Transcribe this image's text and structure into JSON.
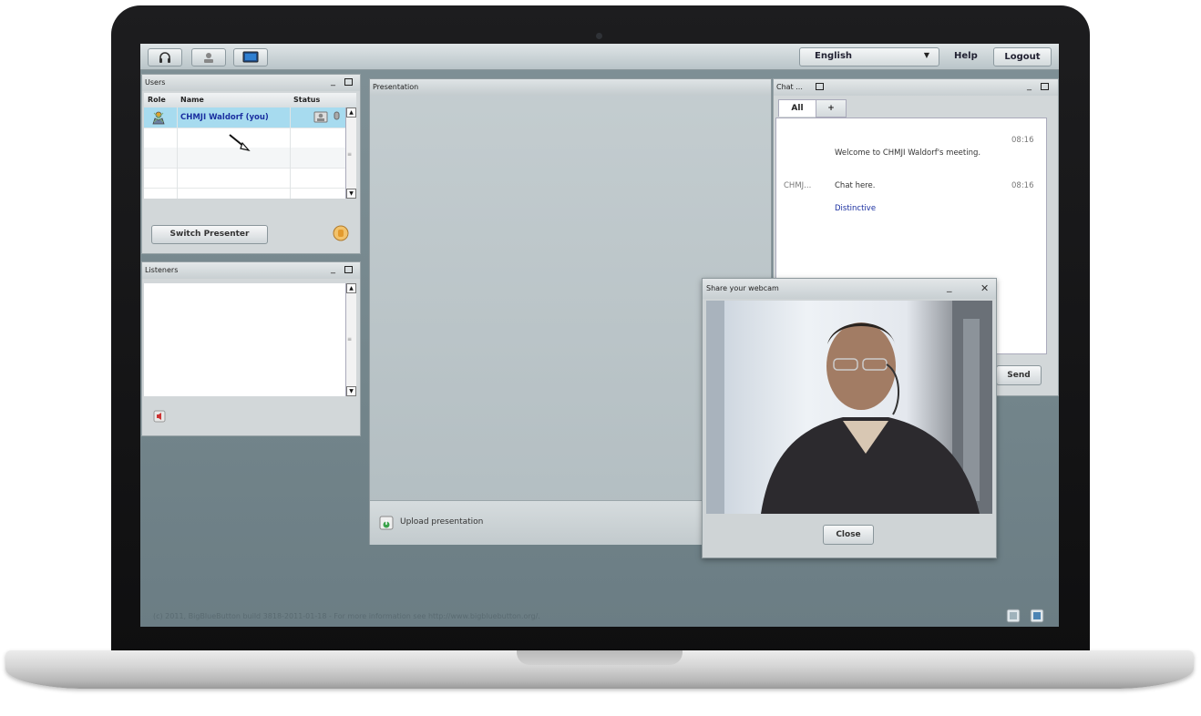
{
  "topbar": {
    "language": "English",
    "help": "Help",
    "logout": "Logout"
  },
  "users": {
    "title": "Users",
    "columns": [
      "Role",
      "Name",
      "Status"
    ],
    "rows": [
      {
        "name": "CHMJI Waldorf (you)"
      }
    ],
    "switch_presenter": "Switch Presenter"
  },
  "listeners": {
    "title": "Listeners"
  },
  "presentation": {
    "title": "Presentation",
    "upload": "Upload presentation"
  },
  "chat": {
    "title": "Chat ...",
    "tabs": [
      "All",
      "+"
    ],
    "messages": [
      {
        "sender": "",
        "text": "Welcome to CHMJI Waldorf's meeting.",
        "time": "08:16"
      },
      {
        "sender": "CHMJ...",
        "text": "Chat here.",
        "time": "08:16"
      },
      {
        "sender": "",
        "text": "Distinctive",
        "time": ""
      }
    ],
    "send": "Send"
  },
  "webcam": {
    "title": "Share your webcam",
    "close": "Close"
  },
  "footer": "(c) 2011, BigBlueButton build 3818-2011-01-18 - For more information see http://www.bigbluebutton.org/.",
  "colors": {
    "screen_bg": "#7a8b91",
    "selected_row": "#a7dbef",
    "link_blue": "#1a2fa0"
  }
}
